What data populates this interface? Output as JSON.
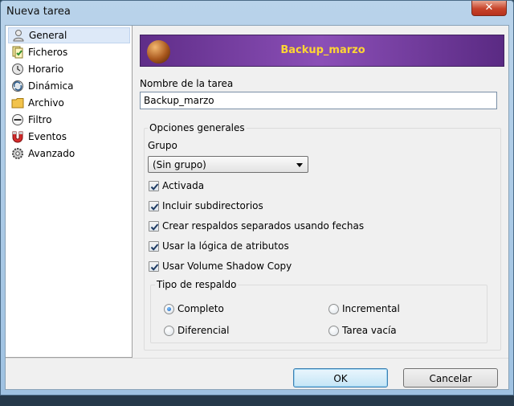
{
  "window": {
    "title": "Nueva tarea",
    "close_glyph": "✕"
  },
  "nav": {
    "items": [
      {
        "label": "General",
        "icon": "user-icon",
        "selected": true
      },
      {
        "label": "Ficheros",
        "icon": "files-icon"
      },
      {
        "label": "Horario",
        "icon": "clock-icon"
      },
      {
        "label": "Dinámica",
        "icon": "dynamic-icon"
      },
      {
        "label": "Archivo",
        "icon": "folder-icon"
      },
      {
        "label": "Filtro",
        "icon": "filter-icon"
      },
      {
        "label": "Eventos",
        "icon": "magnet-icon"
      },
      {
        "label": "Avanzado",
        "icon": "gear-icon"
      }
    ]
  },
  "banner": {
    "title": "Backup_marzo"
  },
  "task_name": {
    "label": "Nombre de la tarea",
    "value": "Backup_marzo"
  },
  "general_options": {
    "legend": "Opciones generales",
    "group_label": "Grupo",
    "group_value": "(Sin grupo)",
    "checkboxes": [
      {
        "label": "Activada",
        "checked": true
      },
      {
        "label": "Incluir subdirectorios",
        "checked": true
      },
      {
        "label": "Crear respaldos separados usando fechas",
        "checked": true
      },
      {
        "label": "Usar la lógica de atributos",
        "checked": true
      },
      {
        "label": "Usar Volume Shadow Copy",
        "checked": true
      }
    ]
  },
  "backup_type": {
    "legend": "Tipo de respaldo",
    "options": [
      {
        "label": "Completo",
        "selected": true
      },
      {
        "label": "Incremental",
        "selected": false
      },
      {
        "label": "Diferencial",
        "selected": false
      },
      {
        "label": "Tarea vacía",
        "selected": false
      }
    ]
  },
  "buttons": {
    "ok": "OK",
    "cancel": "Cancelar"
  },
  "colors": {
    "banner_text": "#ffd633",
    "banner_bg": "#7a3fa8",
    "selection": "#dde9f8"
  }
}
